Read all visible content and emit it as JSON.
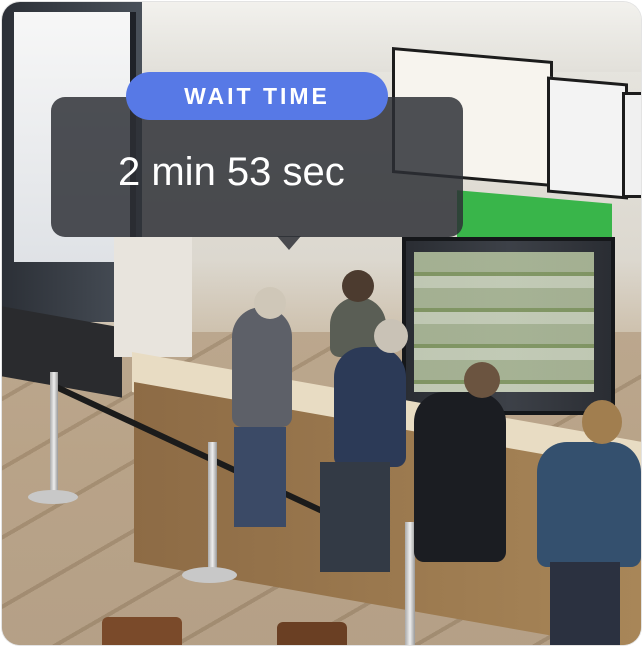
{
  "overlay": {
    "badge_label": "WAIT TIME",
    "wait_value": "2 min 53 sec"
  },
  "colors": {
    "badge_background": "#5779e6",
    "bubble_background": "#2c2e35",
    "text": "#ffffff"
  }
}
